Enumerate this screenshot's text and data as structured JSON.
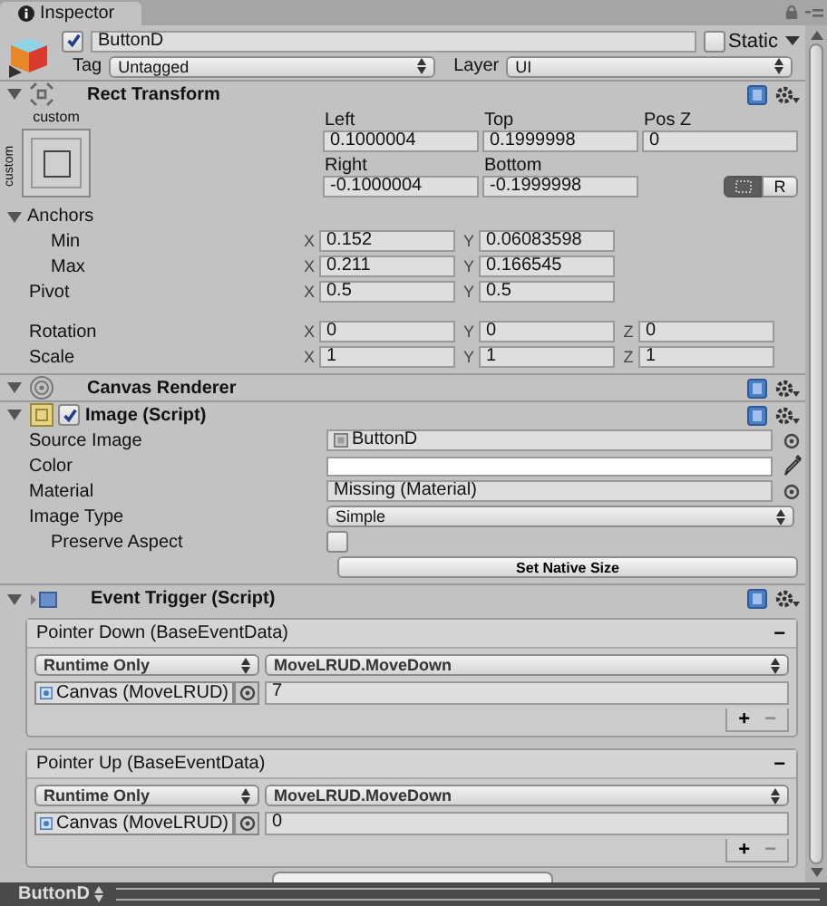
{
  "tab": {
    "label": "Inspector"
  },
  "object": {
    "active": true,
    "name": "ButtonD",
    "static_label": "Static",
    "static": false,
    "tag_label": "Tag",
    "tag": "Untagged",
    "layer_label": "Layer",
    "layer": "UI"
  },
  "rect_transform": {
    "title": "Rect Transform",
    "expanded": true,
    "preset_label": "custom",
    "preset_side_label": "custom",
    "offsets": [
      [
        {
          "label": "Left",
          "value": "0.1000004"
        },
        {
          "label": "Top",
          "value": "0.1999998"
        },
        {
          "label": "Pos Z",
          "value": "0"
        }
      ],
      [
        {
          "label": "Right",
          "value": "-0.1000004"
        },
        {
          "label": "Bottom",
          "value": "-0.1999998"
        }
      ]
    ],
    "blueprint_mode": true,
    "raw_button": "R",
    "anchors": {
      "label": "Anchors",
      "expanded": true,
      "rows": [
        {
          "label": "Min",
          "fields": [
            {
              "axis": "X",
              "value": "0.152"
            },
            {
              "axis": "Y",
              "value": "0.06083598"
            }
          ]
        },
        {
          "label": "Max",
          "fields": [
            {
              "axis": "X",
              "value": "0.211"
            },
            {
              "axis": "Y",
              "value": "0.166545"
            }
          ]
        }
      ]
    },
    "pivot": {
      "label": "Pivot",
      "fields": [
        {
          "axis": "X",
          "value": "0.5"
        },
        {
          "axis": "Y",
          "value": "0.5"
        }
      ]
    },
    "transform_rows": [
      {
        "label": "Rotation",
        "fields": [
          {
            "axis": "X",
            "value": "0"
          },
          {
            "axis": "Y",
            "value": "0"
          },
          {
            "axis": "Z",
            "value": "0"
          }
        ]
      },
      {
        "label": "Scale",
        "fields": [
          {
            "axis": "X",
            "value": "1"
          },
          {
            "axis": "Y",
            "value": "1"
          },
          {
            "axis": "Z",
            "value": "1"
          }
        ]
      }
    ]
  },
  "canvas_renderer": {
    "title": "Canvas Renderer",
    "expanded": true
  },
  "image": {
    "title": "Image (Script)",
    "enabled": true,
    "expanded": true,
    "properties": [
      {
        "kind": "sprite",
        "label": "Source Image",
        "value": "ButtonD"
      },
      {
        "kind": "color",
        "label": "Color",
        "color": "#ffffff"
      },
      {
        "kind": "object",
        "label": "Material",
        "value": "Missing (Material)"
      },
      {
        "kind": "dropdown",
        "label": "Image Type",
        "value": "Simple"
      },
      {
        "kind": "checkbox",
        "label": "Preserve Aspect",
        "checked": false
      }
    ],
    "button": "Set Native Size"
  },
  "event_trigger": {
    "title": "Event Trigger (Script)",
    "expanded": true,
    "events": [
      {
        "title": "Pointer Down (BaseEventData)",
        "remove": "−",
        "mode": "Runtime Only",
        "function": "MoveLRUD.MoveDown",
        "target": "Canvas (MoveLRUD)",
        "argument": "7",
        "add": "+",
        "remove_listener": "−"
      },
      {
        "title": "Pointer Up (BaseEventData)",
        "remove": "−",
        "mode": "Runtime Only",
        "function": "MoveLRUD.MoveDown",
        "target": "Canvas (MoveLRUD)",
        "argument": "0",
        "add": "+",
        "remove_listener": "−"
      }
    ]
  },
  "status_bar": {
    "label": "ButtonD"
  }
}
